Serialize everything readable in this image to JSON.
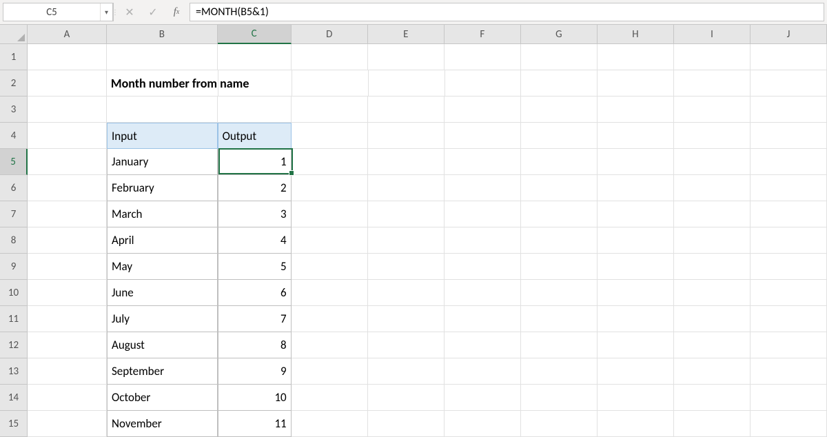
{
  "active_cell": "C5",
  "formula": "=MONTH(B5&1)",
  "columns": [
    "A",
    "B",
    "C",
    "D",
    "E",
    "F",
    "G",
    "H",
    "I",
    "J"
  ],
  "col_widths": {
    "A": "cA",
    "B": "cB",
    "C": "cC",
    "D": "cD",
    "E": "cE",
    "F": "cF",
    "G": "cG",
    "H": "cH",
    "I": "cI",
    "J": "cJ"
  },
  "active_col": "C",
  "rows": [
    1,
    2,
    3,
    4,
    5,
    6,
    7,
    8,
    9,
    10,
    11,
    12,
    13,
    14,
    15
  ],
  "active_row": 5,
  "title": "Month number from name",
  "headers": {
    "input": "Input",
    "output": "Output"
  },
  "table": [
    {
      "input": "January",
      "output": "1"
    },
    {
      "input": "February",
      "output": "2"
    },
    {
      "input": "March",
      "output": "3"
    },
    {
      "input": "April",
      "output": "4"
    },
    {
      "input": "May",
      "output": "5"
    },
    {
      "input": "June",
      "output": "6"
    },
    {
      "input": "July",
      "output": "7"
    },
    {
      "input": "August",
      "output": "8"
    },
    {
      "input": "September",
      "output": "9"
    },
    {
      "input": "October",
      "output": "10"
    },
    {
      "input": "November",
      "output": "11"
    }
  ],
  "icons": {
    "cancel": "✕",
    "enter": "✓",
    "fx": "fx",
    "caret": "▾",
    "dots": "⋮"
  }
}
